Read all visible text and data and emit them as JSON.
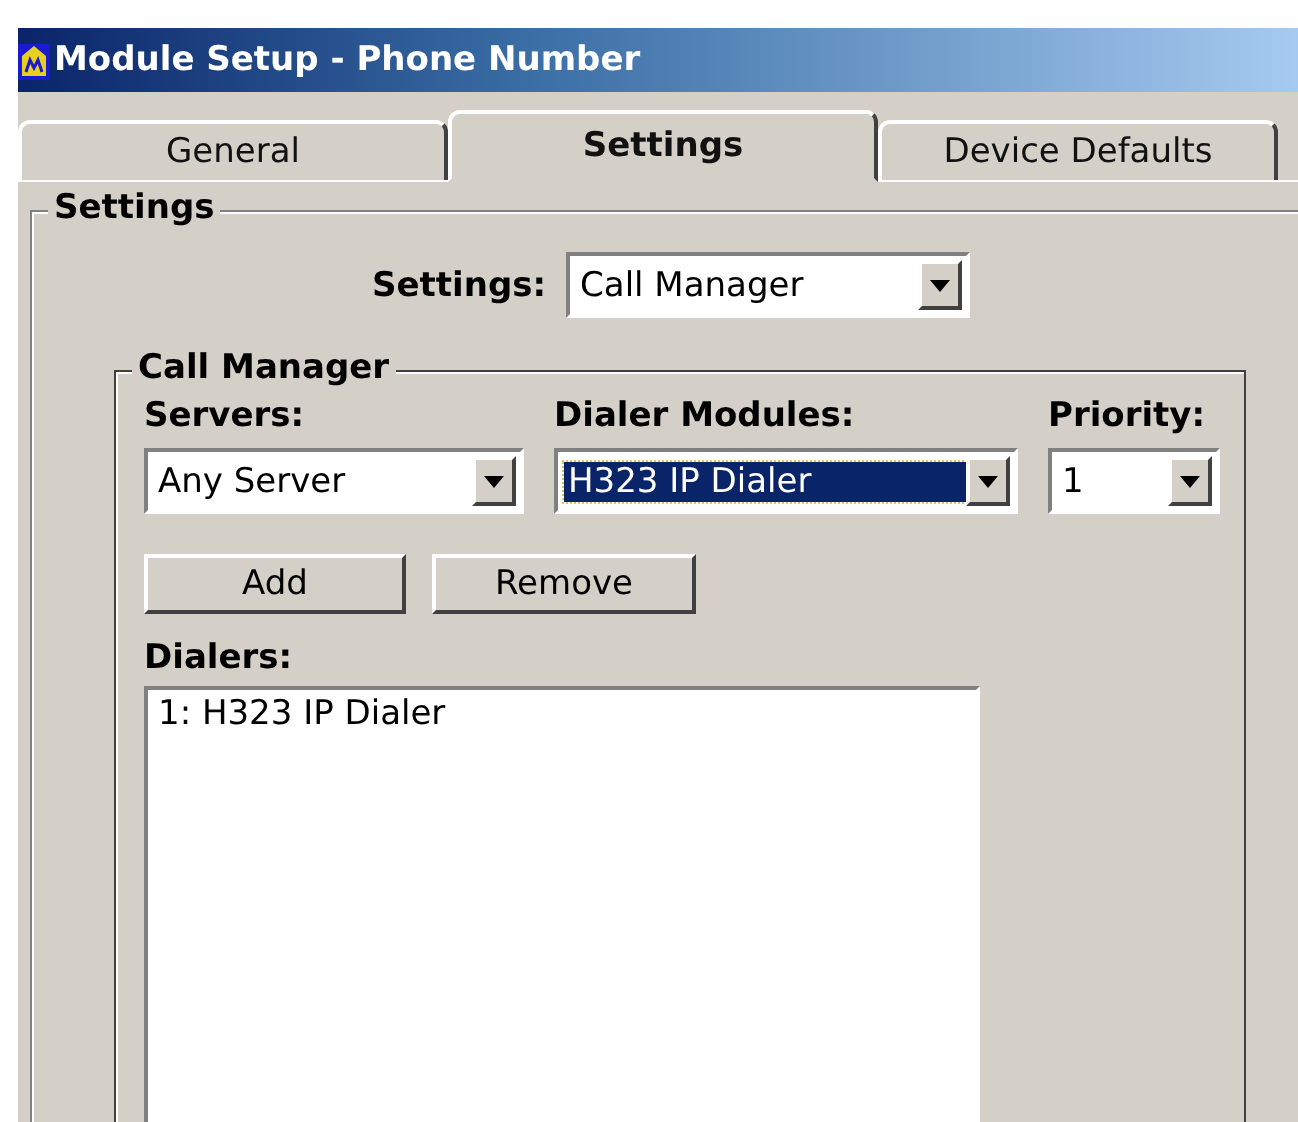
{
  "window": {
    "title": "Module Setup - Phone Number"
  },
  "tabs": [
    {
      "label": "General",
      "selected": false
    },
    {
      "label": "Settings",
      "selected": true
    },
    {
      "label": "Device Defaults",
      "selected": false
    }
  ],
  "settings_group": {
    "title": "Settings",
    "field": {
      "label": "Settings:",
      "value": "Call Manager"
    },
    "call_manager": {
      "title": "Call Manager",
      "combos": [
        {
          "label": "Servers:",
          "value": "Any Server",
          "highlighted": false
        },
        {
          "label": "Dialer Modules:",
          "value": "H323 IP Dialer",
          "highlighted": true
        },
        {
          "label": "Priority:",
          "value": "1",
          "highlighted": false
        }
      ],
      "buttons": [
        "Add",
        "Remove"
      ],
      "dialers": {
        "label": "Dialers:",
        "items": [
          "1: H323 IP Dialer"
        ]
      }
    }
  }
}
